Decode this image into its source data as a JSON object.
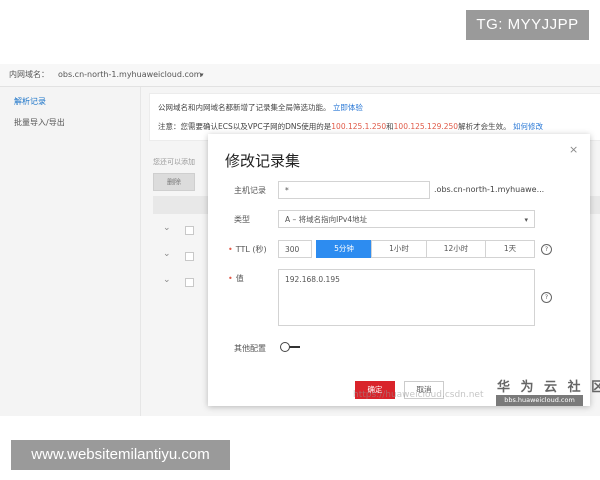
{
  "overlays": {
    "tg_badge": "TG: MYYJJPP",
    "site_badge": "www.websitemilantiyu.com",
    "brand_logo": "华 为 云 社 区",
    "brand_url": "bbs.huaweicloud.com",
    "csdn_watermark": "https://huaweicloud.csdn.net"
  },
  "topbar": {
    "zone_label": "内网域名：",
    "domain": "obs.cn-north-1.myhuaweicloud.com",
    "caret": "▾"
  },
  "sidebar": {
    "items": [
      {
        "label": "解析记录",
        "active": true
      },
      {
        "label": "批量导入/导出",
        "active": false
      }
    ]
  },
  "notice": {
    "line1_text": "公网域名和内网域名都新增了记录集全局筛选功能。",
    "line1_link": "立即体验",
    "line2_prefix": "注意：您需要确认ECS以及VPC子网的DNS使用的是",
    "dns1": "100.125.1.250",
    "line2_and": "和",
    "dns2": "100.125.129.250",
    "line2_suffix": "解析才会生效。",
    "line2_link": "如何修改"
  },
  "background_table": {
    "caption": "您还可以添加",
    "delete_button": "删除",
    "row_caret": "⌄"
  },
  "modal": {
    "title": "修改记录集",
    "close": "×",
    "host_label": "主机记录",
    "host_value": "*",
    "host_suffix": ".obs.cn-north-1.myhuawe...",
    "type_label": "类型",
    "type_value": "A – 将域名指向IPv4地址",
    "ttl_label": "TTL (秒)",
    "ttl_value": "300",
    "ttl_options": [
      {
        "label": "5分钟",
        "selected": true
      },
      {
        "label": "1小时",
        "selected": false
      },
      {
        "label": "12小时",
        "selected": false
      },
      {
        "label": "1天",
        "selected": false
      }
    ],
    "value_label": "值",
    "value_text": "192.168.0.195",
    "advanced_label": "其他配置",
    "advanced_enabled": false,
    "ok_button": "确定",
    "cancel_button": "取消",
    "help_glyph": "?"
  },
  "colors": {
    "primary": "#2d8cf0",
    "confirm": "#d9242b",
    "link": "#2a78d6",
    "alert": "#e05a48"
  }
}
